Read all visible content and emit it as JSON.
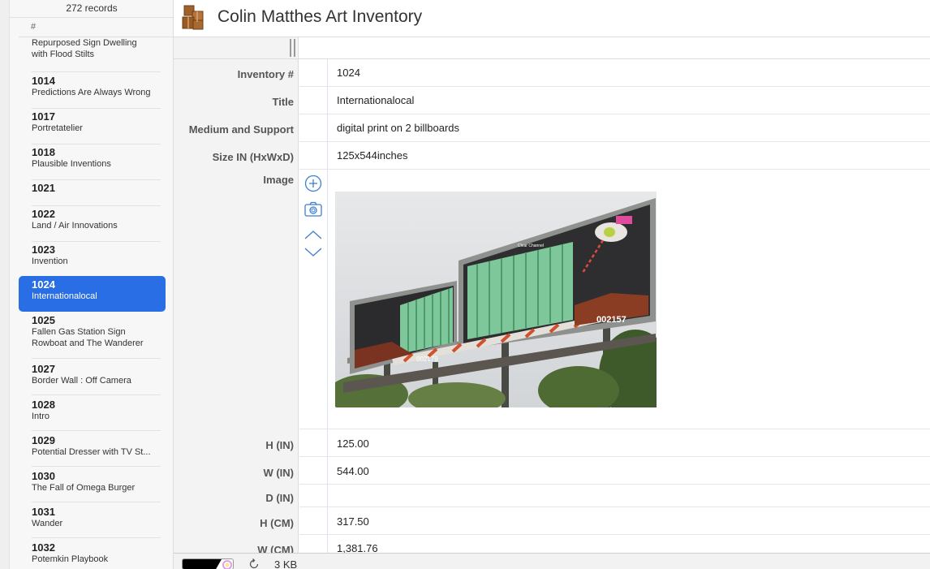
{
  "app": {
    "title": "Colin Matthes Art Inventory",
    "icon": "boxes-icon",
    "accent_color": "#2a6ee6"
  },
  "sidebar": {
    "record_count": "272 records",
    "column_header": "#",
    "records": [
      {
        "number": "",
        "title": "Repurposed Sign Dwelling\nwith Flood Stilts"
      },
      {
        "number": "1014",
        "title": "Predictions Are Always Wrong"
      },
      {
        "number": "1017",
        "title": "Portretatelier"
      },
      {
        "number": "1018",
        "title": "Plausible Inventions"
      },
      {
        "number": "1021",
        "title": ""
      },
      {
        "number": "1022",
        "title": "Land / Air Innovations"
      },
      {
        "number": "1023",
        "title": "Invention"
      },
      {
        "number": "1024",
        "title": "Internationalocal",
        "selected": true
      },
      {
        "number": "1025",
        "title": "Fallen Gas Station Sign\nRowboat and The Wanderer"
      },
      {
        "number": "1027",
        "title": "Border Wall : Off Camera"
      },
      {
        "number": "1028",
        "title": "Intro"
      },
      {
        "number": "1029",
        "title": "Potential Dresser with TV St..."
      },
      {
        "number": "1030",
        "title": "The Fall of Omega Burger"
      },
      {
        "number": "1031",
        "title": "Wander"
      },
      {
        "number": "1032",
        "title": "Potemkin Playbook"
      }
    ]
  },
  "record": {
    "fields": [
      {
        "label": "Inventory #",
        "value": "1024"
      },
      {
        "label": "Title",
        "value": "Internationalocal"
      },
      {
        "label": "Medium and Support",
        "value": "digital print on 2 billboards"
      },
      {
        "label": "Size IN (HxWxD)",
        "value": "125x544inches"
      },
      {
        "label": "Image",
        "value": ""
      },
      {
        "label": "H (IN)",
        "value": "125.00"
      },
      {
        "label": "W (IN)",
        "value": "544.00"
      },
      {
        "label": "D (IN)",
        "value": ""
      },
      {
        "label": "H (CM)",
        "value": "317.50"
      },
      {
        "label": "W (CM)",
        "value": "1,381.76"
      }
    ],
    "image_controls": [
      "add-icon",
      "camera-icon",
      "chevron-up-icon",
      "chevron-down-icon"
    ],
    "billboard_numbers": [
      "002179",
      "002157"
    ],
    "billboard_brand": "Clear Channel"
  },
  "statusbar": {
    "file_size": "3 KB"
  }
}
